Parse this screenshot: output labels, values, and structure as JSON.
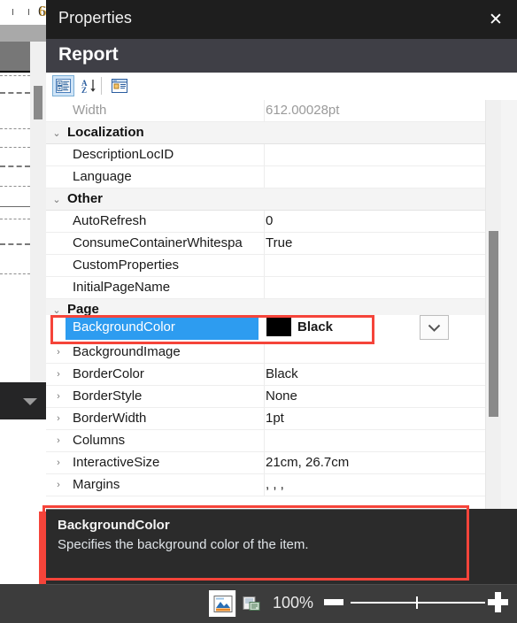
{
  "background": {
    "ruler_label": "6",
    "caret_icon": "triangle-down-icon"
  },
  "panel": {
    "title": "Properties",
    "close_icon": "close-icon",
    "subject": "Report",
    "toolbar": [
      {
        "name": "categorized-view-button",
        "icon": "categorized-icon",
        "selected": true
      },
      {
        "name": "alphabetical-sort-button",
        "icon": "sort-az-icon",
        "selected": false
      },
      {
        "name": "property-pages-button",
        "icon": "property-pages-icon",
        "selected": false
      }
    ]
  },
  "grid": {
    "rows": [
      {
        "kind": "property",
        "expander": "",
        "name": "Width",
        "value": "612.00028pt",
        "dim": true
      },
      {
        "kind": "category",
        "expander": "chevron-down-icon",
        "name": "Localization",
        "value": ""
      },
      {
        "kind": "property",
        "expander": "",
        "name": "DescriptionLocID",
        "value": ""
      },
      {
        "kind": "property",
        "expander": "",
        "name": "Language",
        "value": ""
      },
      {
        "kind": "category",
        "expander": "chevron-down-icon",
        "name": "Other",
        "value": ""
      },
      {
        "kind": "property",
        "expander": "",
        "name": "AutoRefresh",
        "value": "0"
      },
      {
        "kind": "property",
        "expander": "",
        "name": "ConsumeContainerWhitespa",
        "value": "True"
      },
      {
        "kind": "property",
        "expander": "",
        "name": "CustomProperties",
        "value": ""
      },
      {
        "kind": "property",
        "expander": "",
        "name": "InitialPageName",
        "value": ""
      },
      {
        "kind": "category",
        "expander": "chevron-down-icon",
        "name": "Page",
        "value": ""
      },
      {
        "kind": "selected",
        "expander": "",
        "name": "BackgroundColor",
        "value": "Black",
        "swatch": "#000000"
      },
      {
        "kind": "property",
        "expander": "chevron-right-icon",
        "name": "BackgroundImage",
        "value": ""
      },
      {
        "kind": "property",
        "expander": "chevron-right-icon",
        "name": "BorderColor",
        "value": "Black"
      },
      {
        "kind": "property",
        "expander": "chevron-right-icon",
        "name": "BorderStyle",
        "value": "None"
      },
      {
        "kind": "property",
        "expander": "chevron-right-icon",
        "name": "BorderWidth",
        "value": "1pt"
      },
      {
        "kind": "property",
        "expander": "chevron-right-icon",
        "name": "Columns",
        "value": ""
      },
      {
        "kind": "property",
        "expander": "chevron-right-icon",
        "name": "InteractiveSize",
        "value": "21cm, 26.7cm"
      },
      {
        "kind": "property",
        "expander": "chevron-right-icon",
        "name": "Margins",
        "value": ", , ,"
      }
    ],
    "dropdown_icon": "chevron-down-icon",
    "selection_color": "#2d9cf0",
    "annotation_color": "#f5443a"
  },
  "description": {
    "title": "BackgroundColor",
    "text": "Specifies the background color of the item."
  },
  "statusbar": {
    "design_view_icon": "design-view-icon",
    "preview_view_icon": "print-preview-icon",
    "zoom_level": "100%",
    "zoom_out_icon": "minus-icon",
    "zoom_in_icon": "plus-icon"
  }
}
